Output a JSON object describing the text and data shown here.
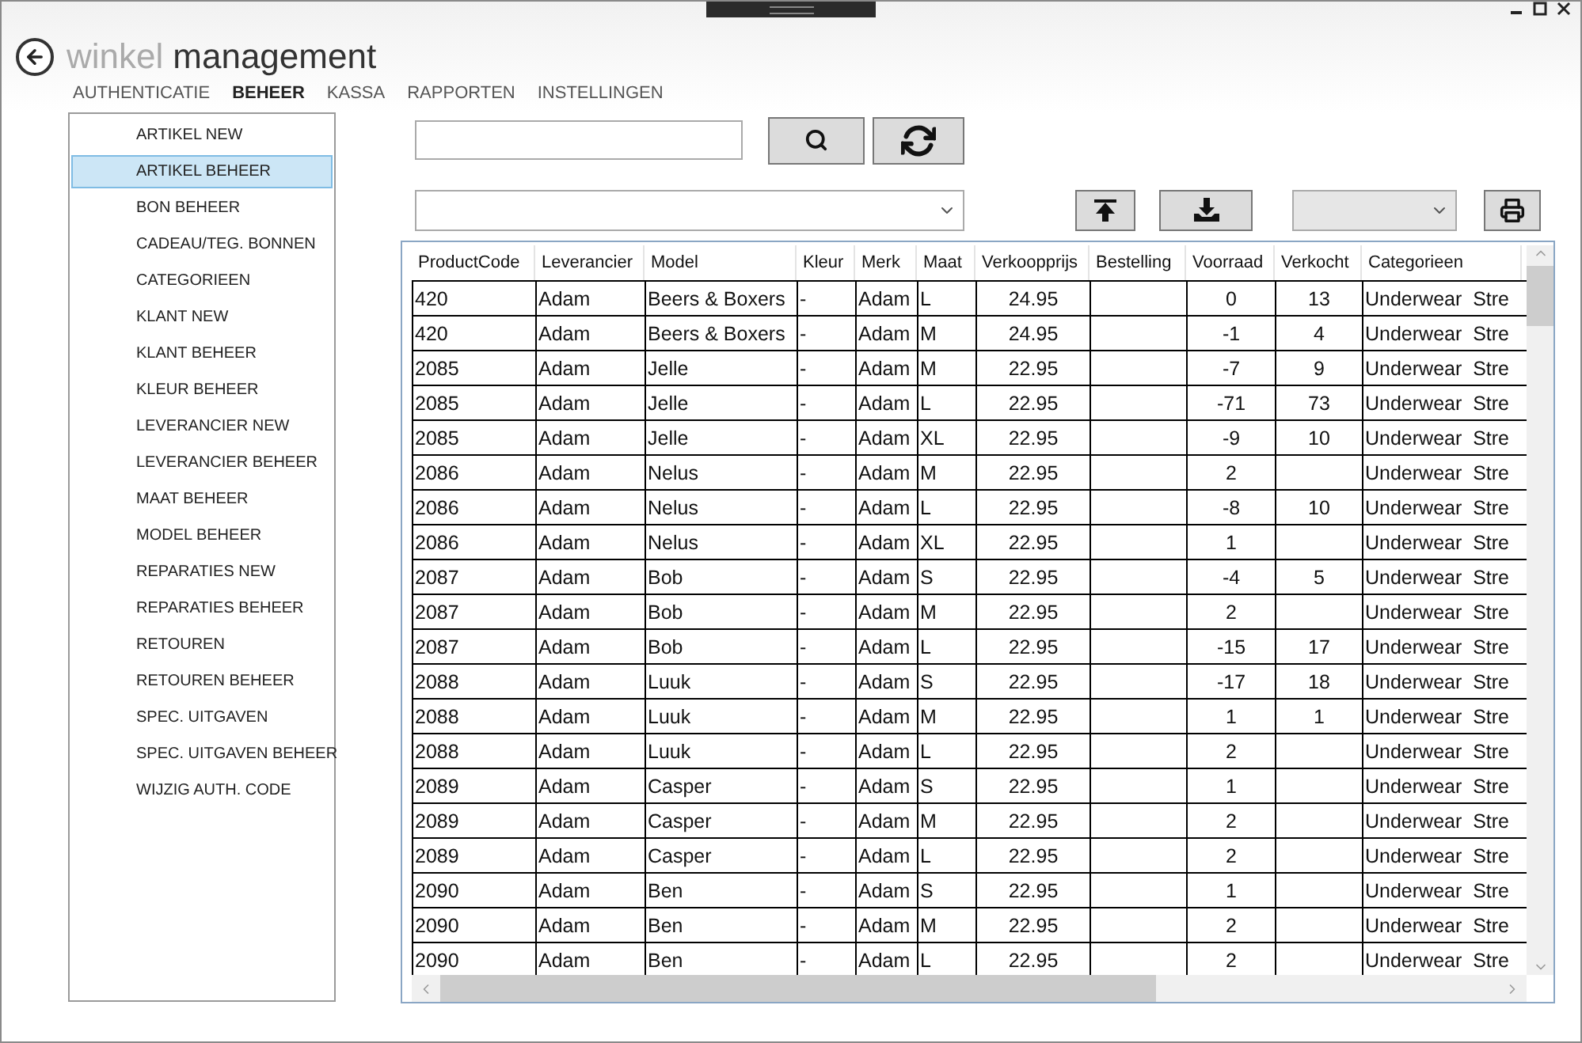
{
  "app_title": {
    "light": "winkel",
    "dark": "management"
  },
  "nav": [
    {
      "label": "AUTHENTICATIE",
      "selected": false
    },
    {
      "label": "BEHEER",
      "selected": true
    },
    {
      "label": "KASSA",
      "selected": false
    },
    {
      "label": "RAPPORTEN",
      "selected": false
    },
    {
      "label": "INSTELLINGEN",
      "selected": false
    }
  ],
  "sidebar": {
    "items": [
      {
        "label": "ARTIKEL NEW",
        "selected": false
      },
      {
        "label": "ARTIKEL BEHEER",
        "selected": true
      },
      {
        "label": "BON BEHEER",
        "selected": false
      },
      {
        "label": "CADEAU/TEG. BONNEN",
        "selected": false
      },
      {
        "label": "CATEGORIEEN",
        "selected": false
      },
      {
        "label": "KLANT NEW",
        "selected": false
      },
      {
        "label": "KLANT BEHEER",
        "selected": false
      },
      {
        "label": "KLEUR BEHEER",
        "selected": false
      },
      {
        "label": "LEVERANCIER NEW",
        "selected": false
      },
      {
        "label": "LEVERANCIER BEHEER",
        "selected": false
      },
      {
        "label": "MAAT BEHEER",
        "selected": false
      },
      {
        "label": "MODEL BEHEER",
        "selected": false
      },
      {
        "label": "REPARATIES NEW",
        "selected": false
      },
      {
        "label": "REPARATIES BEHEER",
        "selected": false
      },
      {
        "label": "RETOUREN",
        "selected": false
      },
      {
        "label": "RETOUREN BEHEER",
        "selected": false
      },
      {
        "label": "SPEC. UITGAVEN",
        "selected": false
      },
      {
        "label": "SPEC. UITGAVEN BEHEER",
        "selected": false
      },
      {
        "label": "WIJZIG AUTH. CODE",
        "selected": false
      }
    ]
  },
  "table": {
    "columns": [
      "ProductCode",
      "Leverancier",
      "Model",
      "Kleur",
      "Merk",
      "Maat",
      "Verkoopprijs",
      "Bestelling",
      "Voorraad",
      "Verkocht",
      "Categorieen"
    ],
    "rows": [
      {
        "code": "420",
        "leverancier": "Adam",
        "model": "Beers & Boxers",
        "kleur": "-",
        "merk": "Adam",
        "maat": "L",
        "prijs": "24.95",
        "voorraad": "0",
        "verkocht": "13",
        "categorie": "Underwear  Stre"
      },
      {
        "code": "420",
        "leverancier": "Adam",
        "model": "Beers & Boxers",
        "kleur": "-",
        "merk": "Adam",
        "maat": "M",
        "prijs": "24.95",
        "voorraad": "-1",
        "verkocht": "4",
        "categorie": "Underwear  Stre"
      },
      {
        "code": "2085",
        "leverancier": "Adam",
        "model": "Jelle",
        "kleur": "-",
        "merk": "Adam",
        "maat": "M",
        "prijs": "22.95",
        "voorraad": "-7",
        "verkocht": "9",
        "categorie": "Underwear  Stre"
      },
      {
        "code": "2085",
        "leverancier": "Adam",
        "model": "Jelle",
        "kleur": "-",
        "merk": "Adam",
        "maat": "L",
        "prijs": "22.95",
        "voorraad": "-71",
        "verkocht": "73",
        "categorie": "Underwear  Stre"
      },
      {
        "code": "2085",
        "leverancier": "Adam",
        "model": "Jelle",
        "kleur": "-",
        "merk": "Adam",
        "maat": "XL",
        "prijs": "22.95",
        "voorraad": "-9",
        "verkocht": "10",
        "categorie": "Underwear  Stre"
      },
      {
        "code": "2086",
        "leverancier": "Adam",
        "model": "Nelus",
        "kleur": "-",
        "merk": "Adam",
        "maat": "M",
        "prijs": "22.95",
        "voorraad": "2",
        "categorie": "Underwear  Stre"
      },
      {
        "code": "2086",
        "leverancier": "Adam",
        "model": "Nelus",
        "kleur": "-",
        "merk": "Adam",
        "maat": "L",
        "prijs": "22.95",
        "voorraad": "-8",
        "verkocht": "10",
        "categorie": "Underwear  Stre"
      },
      {
        "code": "2086",
        "leverancier": "Adam",
        "model": "Nelus",
        "kleur": "-",
        "merk": "Adam",
        "maat": "XL",
        "prijs": "22.95",
        "voorraad": "1",
        "categorie": "Underwear  Stre"
      },
      {
        "code": "2087",
        "leverancier": "Adam",
        "model": "Bob",
        "kleur": "-",
        "merk": "Adam",
        "maat": "S",
        "prijs": "22.95",
        "voorraad": "-4",
        "verkocht": "5",
        "categorie": "Underwear  Stre"
      },
      {
        "code": "2087",
        "leverancier": "Adam",
        "model": "Bob",
        "kleur": "-",
        "merk": "Adam",
        "maat": "M",
        "prijs": "22.95",
        "voorraad": "2",
        "categorie": "Underwear  Stre"
      },
      {
        "code": "2087",
        "leverancier": "Adam",
        "model": "Bob",
        "kleur": "-",
        "merk": "Adam",
        "maat": "L",
        "prijs": "22.95",
        "voorraad": "-15",
        "verkocht": "17",
        "categorie": "Underwear  Stre"
      },
      {
        "code": "2088",
        "leverancier": "Adam",
        "model": "Luuk",
        "kleur": "-",
        "merk": "Adam",
        "maat": "S",
        "prijs": "22.95",
        "voorraad": "-17",
        "verkocht": "18",
        "categorie": "Underwear  Stre"
      },
      {
        "code": "2088",
        "leverancier": "Adam",
        "model": "Luuk",
        "kleur": "-",
        "merk": "Adam",
        "maat": "M",
        "prijs": "22.95",
        "voorraad": "1",
        "verkocht": "1",
        "categorie": "Underwear  Stre"
      },
      {
        "code": "2088",
        "leverancier": "Adam",
        "model": "Luuk",
        "kleur": "-",
        "merk": "Adam",
        "maat": "L",
        "prijs": "22.95",
        "voorraad": "2",
        "categorie": "Underwear  Stre"
      },
      {
        "code": "2089",
        "leverancier": "Adam",
        "model": "Casper",
        "kleur": "-",
        "merk": "Adam",
        "maat": "S",
        "prijs": "22.95",
        "voorraad": "1",
        "categorie": "Underwear  Stre"
      },
      {
        "code": "2089",
        "leverancier": "Adam",
        "model": "Casper",
        "kleur": "-",
        "merk": "Adam",
        "maat": "M",
        "prijs": "22.95",
        "voorraad": "2",
        "categorie": "Underwear  Stre"
      },
      {
        "code": "2089",
        "leverancier": "Adam",
        "model": "Casper",
        "kleur": "-",
        "merk": "Adam",
        "maat": "L",
        "prijs": "22.95",
        "voorraad": "2",
        "categorie": "Underwear  Stre"
      },
      {
        "code": "2090",
        "leverancier": "Adam",
        "model": "Ben",
        "kleur": "-",
        "merk": "Adam",
        "maat": "S",
        "prijs": "22.95",
        "voorraad": "1",
        "categorie": "Underwear  Stre"
      },
      {
        "code": "2090",
        "leverancier": "Adam",
        "model": "Ben",
        "kleur": "-",
        "merk": "Adam",
        "maat": "M",
        "prijs": "22.95",
        "voorraad": "2",
        "categorie": "Underwear  Stre"
      },
      {
        "code": "2090",
        "leverancier": "Adam",
        "model": "Ben",
        "kleur": "-",
        "merk": "Adam",
        "maat": "L",
        "prijs": "22.95",
        "voorraad": "2",
        "categorie": "Underwear  Stre"
      }
    ]
  }
}
